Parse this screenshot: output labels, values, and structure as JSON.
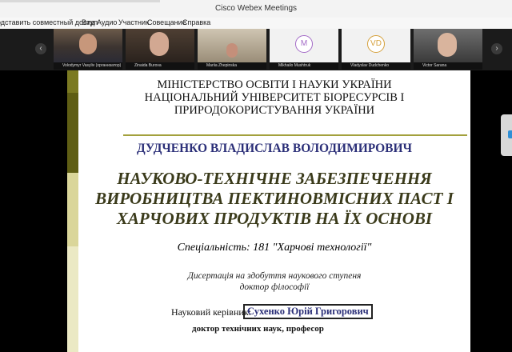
{
  "window": {
    "title": "Cisco Webex Meetings"
  },
  "menu": {
    "share": "одставить совместный доступ",
    "view": "Вид",
    "audio": "Аудио",
    "participant": "Участник",
    "meeting": "Совещание",
    "help": "Справка"
  },
  "participants": [
    {
      "name": "Volodymyr Vasyliv (организатор)",
      "video": true
    },
    {
      "name": "Zinaida Burova",
      "video": true
    },
    {
      "name": "Mariia Zhepinska",
      "video": true
    },
    {
      "name": "Mikhailo Mushtruk",
      "initials": "M",
      "video": false
    },
    {
      "name": "Vladyslav Dudchenko",
      "initials": "VD",
      "video": false
    },
    {
      "name": "Victor Sarana",
      "video": true
    }
  ],
  "strip": {
    "prev_icon": "‹",
    "next_icon": "›"
  },
  "slide": {
    "ministry_lines": [
      "МІНІСТЕРСТВО ОСВІТИ І НАУКИ УКРАЇНИ",
      "НАЦІОНАЛЬНИЙ УНІВЕРСИТЕТ БІОРЕСУРСІВ І",
      "ПРИРОДОКОРИСТУВАННЯ УКРАЇНИ"
    ],
    "author": "ДУДЧЕНКО ВЛАДИСЛАВ ВОЛОДИМИРОВИЧ",
    "topic_lines": [
      "НАУКОВО-ТЕХНІЧНЕ ЗАБЕЗПЕЧЕННЯ",
      "ВИРОБНИЦТВА ПЕКТИНОВМІСНИХ ПАСТ І",
      "ХАРЧОВИХ ПРОДУКТІВ НА ЇХ ОСНОВІ"
    ],
    "specialty": "Спеціальність: 181 \"Харчові технології\"",
    "dissertation_lines": [
      "Дисертація на здобуття наукового ступеня",
      "доктор філософії"
    ],
    "supervisor_label": "Науковий керівник:",
    "supervisor_name": "Сухенко Юрій Григорович",
    "supervisor_degree": "доктор технічних наук, професор"
  },
  "colors": {
    "accent": "#2f8fd6",
    "author_blue": "#2b2f78",
    "olive_bar": "#7b7a22",
    "topic": "#3a3a1a"
  }
}
